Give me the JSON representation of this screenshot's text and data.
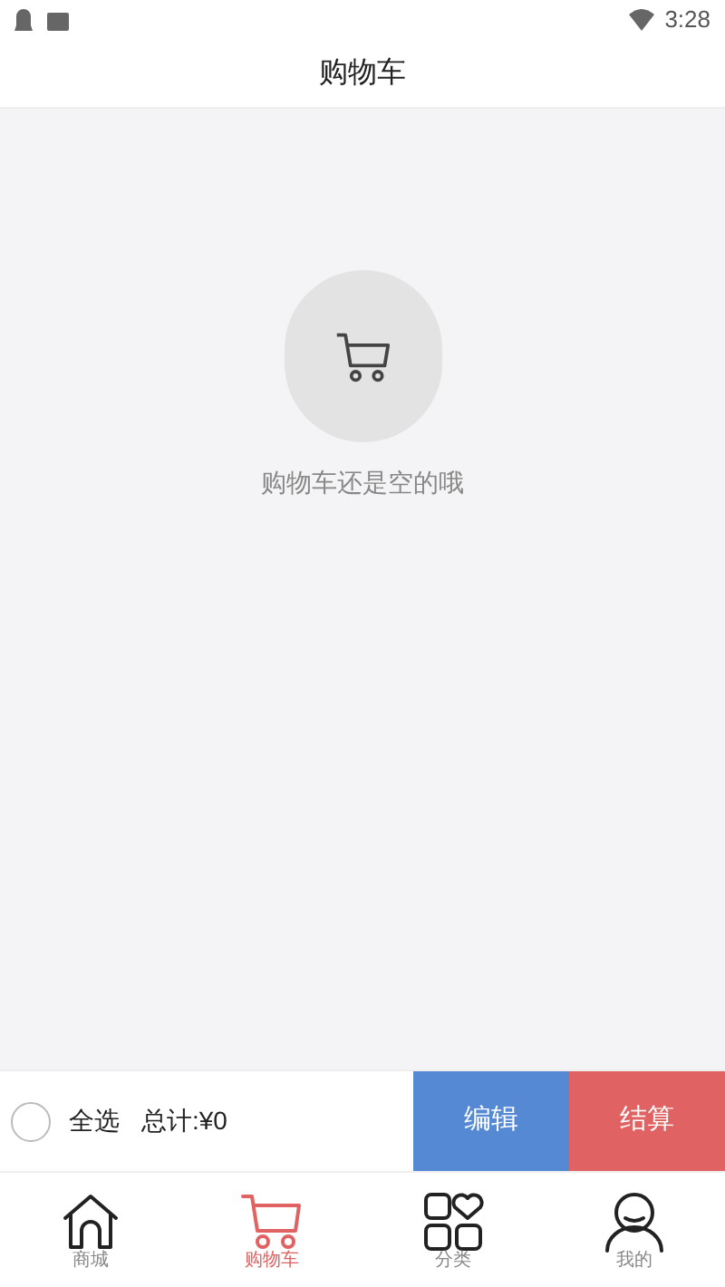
{
  "status_bar": {
    "time": "3:28"
  },
  "header": {
    "title": "购物车"
  },
  "empty_state": {
    "message": "购物车还是空的哦"
  },
  "checkout_bar": {
    "select_all": {
      "label": "全选",
      "checked": false
    },
    "total": "总计:¥0",
    "buttons": [
      {
        "kind": "edit",
        "label": "编辑"
      },
      {
        "kind": "checkout",
        "label": "结算"
      }
    ]
  },
  "tab_bar": [
    {
      "kind": "home",
      "label": "商城",
      "selected": false
    },
    {
      "kind": "cart",
      "label": "购物车",
      "selected": true
    },
    {
      "kind": "category",
      "label": "分类",
      "selected": false
    },
    {
      "kind": "profile",
      "label": "我的",
      "selected": false
    }
  ]
}
